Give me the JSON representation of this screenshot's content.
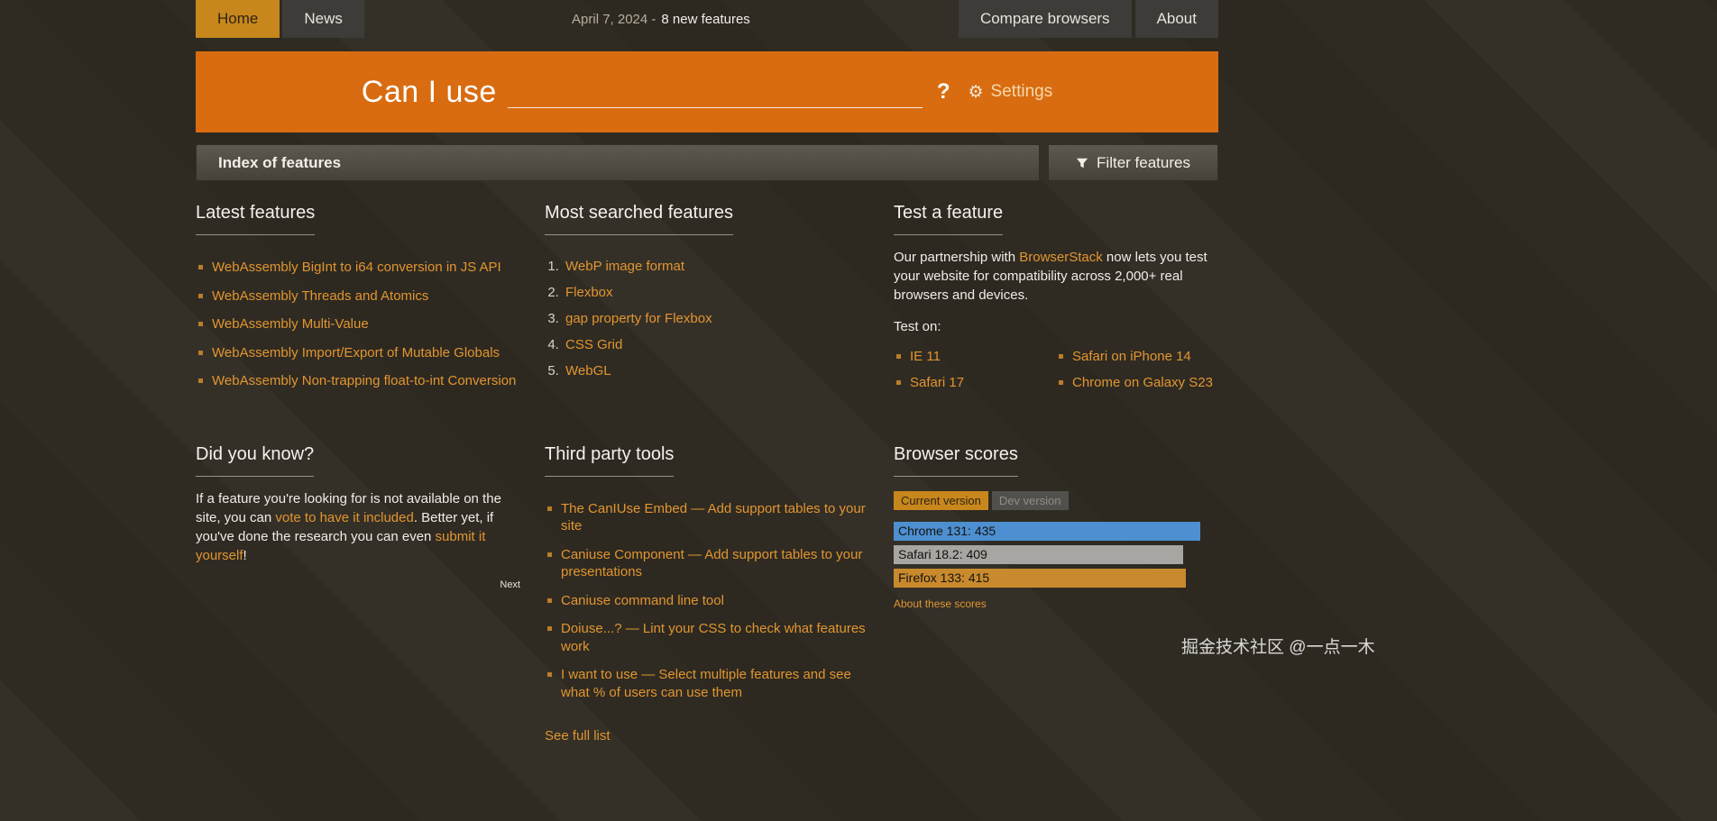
{
  "theme": {
    "banner_orange": "#d96c10",
    "active_tab_orange": "#c8871c",
    "link_orange": "#e2952f"
  },
  "icons": {
    "gear": "⚙",
    "help": "?"
  },
  "topnav": {
    "tabs_left": [
      {
        "label": "Home",
        "active": true
      },
      {
        "label": "News",
        "active": false
      }
    ],
    "date_text": "April 7, 2024 -",
    "new_features_link": "8 new features",
    "tabs_right": [
      {
        "label": "Compare browsers"
      },
      {
        "label": "About"
      }
    ]
  },
  "header": {
    "title": "Can I use",
    "search_value": "",
    "settings_label": "Settings"
  },
  "index_bar": {
    "title": "Index of features",
    "filter_button": "Filter features"
  },
  "latest_features": {
    "heading": "Latest features",
    "items": [
      "WebAssembly BigInt to i64 conversion in JS API",
      "WebAssembly Threads and Atomics",
      "WebAssembly Multi-Value",
      "WebAssembly Import/Export of Mutable Globals",
      "WebAssembly Non-trapping float-to-int Conversion"
    ]
  },
  "most_searched": {
    "heading": "Most searched features",
    "items": [
      "WebP image format",
      "Flexbox",
      "gap property for Flexbox",
      "CSS Grid",
      "WebGL"
    ]
  },
  "test_feature": {
    "heading": "Test a feature",
    "intro_before": "Our partnership with ",
    "intro_link": "BrowserStack",
    "intro_after": " now lets you test your website for compatibility across 2,000+ real browsers and devices.",
    "test_on_label": "Test on:",
    "col1": [
      "IE 11",
      "Safari 17"
    ],
    "col2": [
      "Safari on iPhone 14",
      "Chrome on Galaxy S23"
    ]
  },
  "did_you_know": {
    "heading": "Did you know?",
    "text_1": "If a feature you're looking for is not available on the site, you can ",
    "link_1": "vote to have it included",
    "text_2": ". Better yet, if you've done the research you can even ",
    "link_2": "submit it yourself",
    "text_3": "!",
    "next_label": "Next"
  },
  "third_party": {
    "heading": "Third party tools",
    "items": [
      "The CanIUse Embed — Add support tables to your site",
      "Caniuse Component — Add support tables to your presentations",
      "Caniuse command line tool",
      "Doiuse...? — Lint your CSS to check what features work",
      "I want to use — Select multiple features and see what % of users can use them"
    ],
    "see_full_list": "See full list"
  },
  "browser_scores": {
    "heading": "Browser scores",
    "toggle": [
      {
        "label": "Current version",
        "active": true
      },
      {
        "label": "Dev version",
        "active": false
      }
    ],
    "bars": [
      {
        "label": "Chrome 131: 435",
        "value": 435,
        "color": "#4d8fd1",
        "width": "100%"
      },
      {
        "label": "Safari 18.2: 409",
        "value": 409,
        "color": "#a8a6a2",
        "width": "94.5%"
      },
      {
        "label": "Firefox 133: 415",
        "value": 415,
        "color": "#c98a2e",
        "width": "95.4%"
      }
    ],
    "about_link": "About these scores"
  },
  "watermark": "掘金技术社区 @一点一木"
}
